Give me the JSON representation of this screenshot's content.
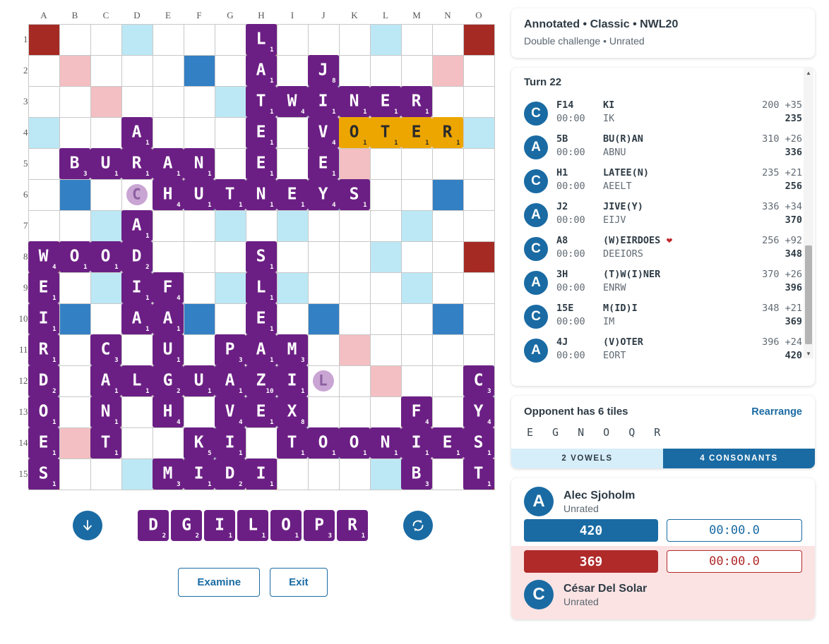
{
  "game_info": {
    "title": "Annotated • Classic • NWL20",
    "subtitle": "Double challenge • Unrated"
  },
  "moves_panel": {
    "turn_label": "Turn 22",
    "moves": [
      {
        "player": "C",
        "pos": "F14",
        "time": "00:00",
        "word": "KI",
        "rack": "IK",
        "before": "200",
        "delta": "+35",
        "total": "235",
        "bingo": false
      },
      {
        "player": "A",
        "pos": "5B",
        "time": "00:00",
        "word": "BU(R)AN",
        "rack": "ABNU",
        "before": "310",
        "delta": "+26",
        "total": "336",
        "bingo": false
      },
      {
        "player": "C",
        "pos": "H1",
        "time": "00:00",
        "word": "LATEE(N)",
        "rack": "AEELT",
        "before": "235",
        "delta": "+21",
        "total": "256",
        "bingo": false
      },
      {
        "player": "A",
        "pos": "J2",
        "time": "00:00",
        "word": "JIVE(Y)",
        "rack": "EIJV",
        "before": "336",
        "delta": "+34",
        "total": "370",
        "bingo": false
      },
      {
        "player": "C",
        "pos": "A8",
        "time": "00:00",
        "word": "(W)EIRDOES",
        "rack": "DEEIORS",
        "before": "256",
        "delta": "+92",
        "total": "348",
        "bingo": true
      },
      {
        "player": "A",
        "pos": "3H",
        "time": "00:00",
        "word": "(T)W(I)NER",
        "rack": "ENRW",
        "before": "370",
        "delta": "+26",
        "total": "396",
        "bingo": false
      },
      {
        "player": "C",
        "pos": "15E",
        "time": "00:00",
        "word": "M(ID)I",
        "rack": "IM",
        "before": "348",
        "delta": "+21",
        "total": "369",
        "bingo": false
      },
      {
        "player": "A",
        "pos": "4J",
        "time": "00:00",
        "word": "(V)OTER",
        "rack": "EORT",
        "before": "396",
        "delta": "+24",
        "total": "420",
        "bingo": false
      }
    ],
    "bingo_icon": "heart-icon",
    "scroll_up_icon": "scroll-up-arrow-icon",
    "scroll_down_icon": "scroll-down-arrow-icon"
  },
  "pool": {
    "header": "Opponent has 6 tiles",
    "rearrange_label": "Rearrange",
    "letters": "E G N O Q R",
    "vowels_label": "2 VOWELS",
    "consonants_label": "4 CONSONANTS"
  },
  "players": {
    "top": {
      "initial": "A",
      "name": "Alec Sjoholm",
      "rating": "Unrated",
      "score": "420",
      "clock": "00:00.0"
    },
    "bottom": {
      "initial": "C",
      "name": "César Del Solar",
      "rating": "Unrated",
      "score": "369",
      "clock": "00:00.0"
    }
  },
  "controls": {
    "shuffle_icon": "refresh-shuffle-icon",
    "recall_icon": "arrow-down-icon",
    "examine_label": "Examine",
    "exit_label": "Exit"
  },
  "rack": {
    "tiles": [
      {
        "letter": "D",
        "value": "2"
      },
      {
        "letter": "G",
        "value": "2"
      },
      {
        "letter": "I",
        "value": "1"
      },
      {
        "letter": "L",
        "value": "1"
      },
      {
        "letter": "O",
        "value": "1"
      },
      {
        "letter": "P",
        "value": "3"
      },
      {
        "letter": "R",
        "value": "1"
      }
    ]
  },
  "board": {
    "columns": [
      "A",
      "B",
      "C",
      "D",
      "E",
      "F",
      "G",
      "H",
      "I",
      "J",
      "K",
      "L",
      "M",
      "N",
      "O"
    ],
    "rows": [
      "1",
      "2",
      "3",
      "4",
      "5",
      "6",
      "7",
      "8",
      "9",
      "10",
      "11",
      "12",
      "13",
      "14",
      "15"
    ],
    "colors": {
      "triple_word": "#a52a24",
      "double_word": "#f3bfc2",
      "triple_letter": "#3480c4",
      "double_letter": "#bce8f5",
      "tile": "#6b1f84",
      "last_play": "#eda600"
    },
    "premium": [
      [
        "tws",
        "",
        "",
        "dls",
        "",
        "",
        "",
        "tws",
        "",
        "",
        "",
        "dls",
        "",
        "",
        "tws"
      ],
      [
        "",
        "dws",
        "",
        "",
        "",
        "tls",
        "",
        "",
        "",
        "tls",
        "",
        "",
        "",
        "dws",
        ""
      ],
      [
        "",
        "",
        "dws",
        "",
        "",
        "",
        "dls",
        "",
        "dls",
        "",
        "",
        "",
        "dws",
        "",
        ""
      ],
      [
        "dls",
        "",
        "",
        "dws",
        "",
        "",
        "",
        "dls",
        "",
        "",
        "",
        "dws",
        "",
        "",
        "dls"
      ],
      [
        "",
        "",
        "",
        "",
        "dws",
        "",
        "",
        "",
        "",
        "",
        "dws",
        "",
        "",
        "",
        ""
      ],
      [
        "",
        "tls",
        "",
        "",
        "",
        "tls",
        "",
        "",
        "",
        "tls",
        "",
        "",
        "",
        "tls",
        ""
      ],
      [
        "",
        "",
        "dls",
        "",
        "",
        "",
        "dls",
        "",
        "dls",
        "",
        "",
        "",
        "dls",
        "",
        ""
      ],
      [
        "tws",
        "",
        "",
        "dls",
        "",
        "",
        "",
        "dws",
        "",
        "",
        "",
        "dls",
        "",
        "",
        "tws"
      ],
      [
        "",
        "",
        "dls",
        "",
        "",
        "",
        "dls",
        "",
        "dls",
        "",
        "",
        "",
        "dls",
        "",
        ""
      ],
      [
        "",
        "tls",
        "",
        "",
        "",
        "tls",
        "",
        "",
        "",
        "tls",
        "",
        "",
        "",
        "tls",
        ""
      ],
      [
        "",
        "",
        "",
        "",
        "dws",
        "",
        "",
        "",
        "",
        "",
        "dws",
        "",
        "",
        "",
        ""
      ],
      [
        "dls",
        "",
        "",
        "dws",
        "",
        "",
        "",
        "dls",
        "",
        "",
        "",
        "dws",
        "",
        "",
        "dls"
      ],
      [
        "",
        "",
        "dws",
        "",
        "",
        "",
        "dls",
        "",
        "dls",
        "",
        "",
        "",
        "dws",
        "",
        ""
      ],
      [
        "",
        "dws",
        "",
        "",
        "",
        "tls",
        "",
        "",
        "",
        "tls",
        "",
        "",
        "",
        "dws",
        ""
      ],
      [
        "tws",
        "",
        "",
        "dls",
        "",
        "",
        "",
        "tws",
        "",
        "",
        "",
        "dls",
        "",
        "",
        "tws"
      ]
    ],
    "tiles": [
      {
        "r": 1,
        "c": 7,
        "letter": "L",
        "value": "1"
      },
      {
        "r": 2,
        "c": 7,
        "letter": "A",
        "value": "1"
      },
      {
        "r": 2,
        "c": 9,
        "letter": "J",
        "value": "8"
      },
      {
        "r": 3,
        "c": 7,
        "letter": "T",
        "value": "1"
      },
      {
        "r": 3,
        "c": 8,
        "letter": "W",
        "value": "4"
      },
      {
        "r": 3,
        "c": 9,
        "letter": "I",
        "value": "1"
      },
      {
        "r": 3,
        "c": 10,
        "letter": "N",
        "value": "1"
      },
      {
        "r": 3,
        "c": 11,
        "letter": "E",
        "value": "1"
      },
      {
        "r": 3,
        "c": 12,
        "letter": "R",
        "value": "1"
      },
      {
        "r": 4,
        "c": 3,
        "letter": "A",
        "value": "1"
      },
      {
        "r": 4,
        "c": 7,
        "letter": "E",
        "value": "1"
      },
      {
        "r": 4,
        "c": 9,
        "letter": "V",
        "value": "4"
      },
      {
        "r": 4,
        "c": 10,
        "letter": "O",
        "value": "1",
        "last": true
      },
      {
        "r": 4,
        "c": 11,
        "letter": "T",
        "value": "1",
        "last": true
      },
      {
        "r": 4,
        "c": 12,
        "letter": "E",
        "value": "1",
        "last": true
      },
      {
        "r": 4,
        "c": 13,
        "letter": "R",
        "value": "1",
        "last": true
      },
      {
        "r": 5,
        "c": 1,
        "letter": "B",
        "value": "3"
      },
      {
        "r": 5,
        "c": 2,
        "letter": "U",
        "value": "1"
      },
      {
        "r": 5,
        "c": 3,
        "letter": "R",
        "value": "1"
      },
      {
        "r": 5,
        "c": 4,
        "letter": "A",
        "value": "1"
      },
      {
        "r": 5,
        "c": 5,
        "letter": "N",
        "value": "1"
      },
      {
        "r": 5,
        "c": 7,
        "letter": "E",
        "value": "1"
      },
      {
        "r": 5,
        "c": 9,
        "letter": "E",
        "value": "1"
      },
      {
        "r": 6,
        "c": 3,
        "letter": "C",
        "value": "0",
        "blank": true
      },
      {
        "r": 6,
        "c": 4,
        "letter": "H",
        "value": "4"
      },
      {
        "r": 6,
        "c": 5,
        "letter": "U",
        "value": "1"
      },
      {
        "r": 6,
        "c": 6,
        "letter": "T",
        "value": "1"
      },
      {
        "r": 6,
        "c": 7,
        "letter": "N",
        "value": "1"
      },
      {
        "r": 6,
        "c": 8,
        "letter": "E",
        "value": "1"
      },
      {
        "r": 6,
        "c": 9,
        "letter": "Y",
        "value": "4"
      },
      {
        "r": 6,
        "c": 10,
        "letter": "S",
        "value": "1"
      },
      {
        "r": 7,
        "c": 3,
        "letter": "A",
        "value": "1"
      },
      {
        "r": 8,
        "c": 0,
        "letter": "W",
        "value": "4"
      },
      {
        "r": 8,
        "c": 1,
        "letter": "O",
        "value": "1"
      },
      {
        "r": 8,
        "c": 2,
        "letter": "O",
        "value": "1"
      },
      {
        "r": 8,
        "c": 3,
        "letter": "D",
        "value": "2"
      },
      {
        "r": 8,
        "c": 7,
        "letter": "S",
        "value": "1"
      },
      {
        "r": 9,
        "c": 0,
        "letter": "E",
        "value": "1"
      },
      {
        "r": 9,
        "c": 3,
        "letter": "I",
        "value": "1"
      },
      {
        "r": 9,
        "c": 4,
        "letter": "F",
        "value": "4"
      },
      {
        "r": 9,
        "c": 7,
        "letter": "L",
        "value": "1"
      },
      {
        "r": 10,
        "c": 0,
        "letter": "I",
        "value": "1"
      },
      {
        "r": 10,
        "c": 3,
        "letter": "A",
        "value": "1"
      },
      {
        "r": 10,
        "c": 4,
        "letter": "A",
        "value": "1"
      },
      {
        "r": 10,
        "c": 7,
        "letter": "E",
        "value": "1"
      },
      {
        "r": 11,
        "c": 0,
        "letter": "R",
        "value": "1"
      },
      {
        "r": 11,
        "c": 2,
        "letter": "C",
        "value": "3"
      },
      {
        "r": 11,
        "c": 4,
        "letter": "U",
        "value": "1"
      },
      {
        "r": 11,
        "c": 6,
        "letter": "P",
        "value": "3"
      },
      {
        "r": 11,
        "c": 7,
        "letter": "A",
        "value": "1"
      },
      {
        "r": 11,
        "c": 8,
        "letter": "M",
        "value": "3"
      },
      {
        "r": 12,
        "c": 0,
        "letter": "D",
        "value": "2"
      },
      {
        "r": 12,
        "c": 2,
        "letter": "A",
        "value": "1"
      },
      {
        "r": 12,
        "c": 3,
        "letter": "L",
        "value": "1"
      },
      {
        "r": 12,
        "c": 4,
        "letter": "G",
        "value": "2"
      },
      {
        "r": 12,
        "c": 5,
        "letter": "U",
        "value": "1"
      },
      {
        "r": 12,
        "c": 6,
        "letter": "A",
        "value": "1"
      },
      {
        "r": 12,
        "c": 7,
        "letter": "Z",
        "value": "10"
      },
      {
        "r": 12,
        "c": 8,
        "letter": "I",
        "value": "1"
      },
      {
        "r": 12,
        "c": 9,
        "letter": "L",
        "value": "0",
        "blank": true
      },
      {
        "r": 12,
        "c": 14,
        "letter": "C",
        "value": "3"
      },
      {
        "r": 13,
        "c": 0,
        "letter": "O",
        "value": "1"
      },
      {
        "r": 13,
        "c": 2,
        "letter": "N",
        "value": "1"
      },
      {
        "r": 13,
        "c": 4,
        "letter": "H",
        "value": "4"
      },
      {
        "r": 13,
        "c": 6,
        "letter": "V",
        "value": "4"
      },
      {
        "r": 13,
        "c": 7,
        "letter": "E",
        "value": "1"
      },
      {
        "r": 13,
        "c": 8,
        "letter": "X",
        "value": "8"
      },
      {
        "r": 13,
        "c": 12,
        "letter": "F",
        "value": "4"
      },
      {
        "r": 13,
        "c": 14,
        "letter": "Y",
        "value": "4"
      },
      {
        "r": 14,
        "c": 0,
        "letter": "E",
        "value": "1"
      },
      {
        "r": 14,
        "c": 2,
        "letter": "T",
        "value": "1"
      },
      {
        "r": 14,
        "c": 5,
        "letter": "K",
        "value": "5"
      },
      {
        "r": 14,
        "c": 6,
        "letter": "I",
        "value": "1"
      },
      {
        "r": 14,
        "c": 8,
        "letter": "T",
        "value": "1"
      },
      {
        "r": 14,
        "c": 9,
        "letter": "O",
        "value": "1"
      },
      {
        "r": 14,
        "c": 10,
        "letter": "O",
        "value": "1"
      },
      {
        "r": 14,
        "c": 11,
        "letter": "N",
        "value": "1"
      },
      {
        "r": 14,
        "c": 12,
        "letter": "I",
        "value": "1"
      },
      {
        "r": 14,
        "c": 13,
        "letter": "E",
        "value": "1"
      },
      {
        "r": 14,
        "c": 14,
        "letter": "S",
        "value": "1"
      },
      {
        "r": 15,
        "c": 0,
        "letter": "S",
        "value": "1"
      },
      {
        "r": 15,
        "c": 4,
        "letter": "M",
        "value": "3"
      },
      {
        "r": 15,
        "c": 5,
        "letter": "I",
        "value": "1"
      },
      {
        "r": 15,
        "c": 6,
        "letter": "D",
        "value": "2"
      },
      {
        "r": 15,
        "c": 7,
        "letter": "I",
        "value": "1"
      },
      {
        "r": 15,
        "c": 12,
        "letter": "B",
        "value": "3"
      },
      {
        "r": 15,
        "c": 14,
        "letter": "T",
        "value": "1"
      }
    ]
  }
}
